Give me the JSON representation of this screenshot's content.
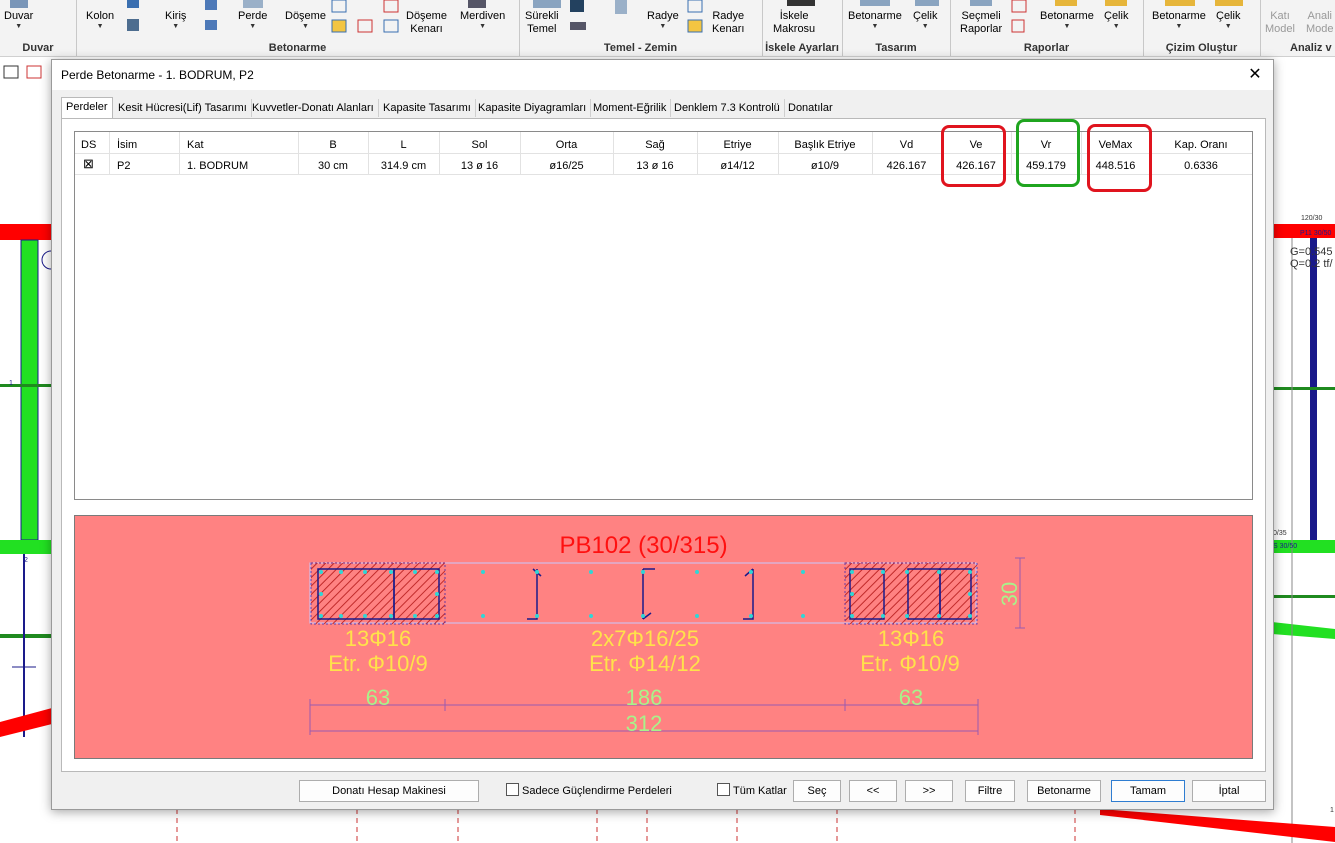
{
  "ribbon": {
    "buttons": [
      {
        "label": "Duvar",
        "dropdown": true
      },
      {
        "label": "Kolon",
        "dropdown": true
      },
      {
        "label": "Kiriş",
        "dropdown": true
      },
      {
        "label": "Perde",
        "dropdown": true
      },
      {
        "label": "Döşeme",
        "dropdown": true
      },
      {
        "label": "Döşeme\nKenarı",
        "dropdown": true
      },
      {
        "label": "Merdiven",
        "dropdown": true
      },
      {
        "label": "Sürekli\nTemel",
        "dropdown": true
      },
      {
        "label": "Radye",
        "dropdown": true
      },
      {
        "label": "Radye\nKenarı",
        "dropdown": true
      },
      {
        "label": "İskele\nMakrosu",
        "dropdown": true
      },
      {
        "label": "Betonarme",
        "dropdown": true
      },
      {
        "label": "Çelik",
        "dropdown": true
      },
      {
        "label": "Seçmeli\nRaporlar",
        "dropdown": false
      },
      {
        "label": "Betonarme",
        "dropdown": true
      },
      {
        "label": "Çelik",
        "dropdown": true
      },
      {
        "label": "Betonarme",
        "dropdown": true
      },
      {
        "label": "Çelik",
        "dropdown": true
      },
      {
        "label": "Katı\nModel",
        "dropdown": false
      },
      {
        "label": "Anali\nMode",
        "dropdown": false
      }
    ],
    "groups": [
      {
        "label": "Duvar"
      },
      {
        "label": "Betonarme"
      },
      {
        "label": "Temel - Zemin"
      },
      {
        "label": "İskele Ayarları"
      },
      {
        "label": "Tasarım"
      },
      {
        "label": "Raporlar"
      },
      {
        "label": "Çizim Oluştur"
      },
      {
        "label": "Analiz v"
      }
    ]
  },
  "background": {
    "right_labels": [
      "120/30",
      "P11 30/50",
      "G=0.545",
      "Q=0.2 tf/",
      "S 30/50",
      "0/35",
      "1"
    ],
    "left_labels": [
      "1",
      "2"
    ]
  },
  "dialog": {
    "title": "Perde Betonarme - 1. BODRUM, P2",
    "tabs": [
      {
        "label": "Perdeler",
        "active": true
      },
      {
        "label": "Kesit Hücresi(Lif) Tasarımı",
        "active": false
      },
      {
        "label": "Kuvvetler-Donatı Alanları",
        "active": false
      },
      {
        "label": "Kapasite Tasarımı",
        "active": false
      },
      {
        "label": "Kapasite Diyagramları",
        "active": false
      },
      {
        "label": "Moment-Eğrilik",
        "active": false
      },
      {
        "label": "Denklem 7.3 Kontrolü",
        "active": false
      },
      {
        "label": "Donatılar",
        "active": false
      }
    ],
    "table": {
      "columns": [
        "DS",
        "İsim",
        "Kat",
        "B",
        "L",
        "Sol",
        "Orta",
        "Sağ",
        "Etriye",
        "Başlık Etriye",
        "Vd",
        "Ve",
        "Vr",
        "VeMax",
        "Kap. Oranı"
      ],
      "rows": [
        {
          "ds": "⊠",
          "isim": "P2",
          "kat": "1. BODRUM",
          "b": "30 cm",
          "l": "314.9 cm",
          "sol": "13 ø 16",
          "orta": "ø16/25",
          "sag": "13 ø 16",
          "etriye": "ø14/12",
          "baslik_etriye": "ø10/9",
          "vd": "426.167",
          "ve": "426.167",
          "vr": "459.179",
          "vemax": "448.516",
          "kap_orani": "0.6336"
        }
      ],
      "highlight_colors": {
        "ve": "#e0141e",
        "vr": "#1fa51f",
        "vemax": "#e0141e"
      }
    },
    "section": {
      "title": "PB102 (30/315)",
      "left_bars": "13Φ16",
      "left_stirrup": "Etr. Φ10/9",
      "mid_bars": "2x7Φ16/25",
      "mid_stirrup": "Etr. Φ14/12",
      "right_bars": "13Φ16",
      "right_stirrup": "Etr. Φ10/9",
      "dim_left": "63",
      "dim_mid": "186",
      "dim_right": "63",
      "dim_total": "312",
      "dim_thickness": "30",
      "bg_color": "#ff8282"
    },
    "buttons": {
      "calculator": "Donatı Hesap Makinesi",
      "strengthen_only": "Sadece Güçlendirme Perdeleri",
      "all_floors": "Tüm Katlar",
      "select": "Seç",
      "prev": "<<",
      "next": ">>",
      "filter": "Filtre",
      "reinforced": "Betonarme",
      "ok": "Tamam",
      "cancel": "İptal"
    }
  }
}
